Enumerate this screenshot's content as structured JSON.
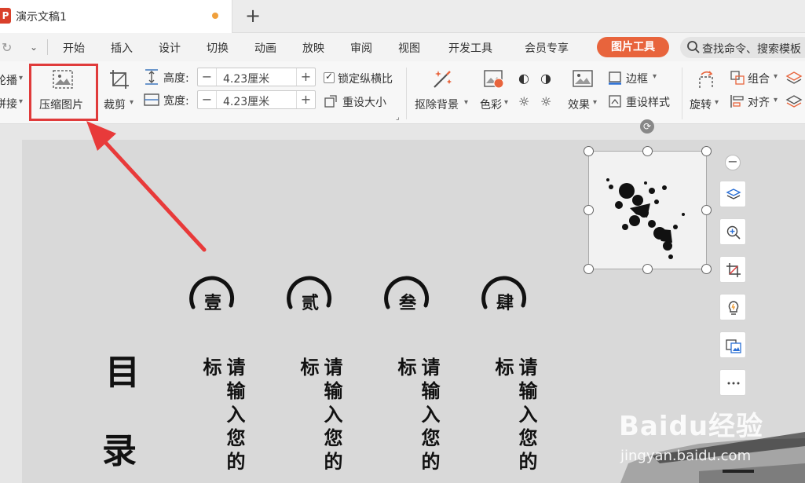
{
  "titlebar": {
    "logo": "P",
    "doc_title": "演示文稿1",
    "new_tab": "+"
  },
  "menu": {
    "items": [
      "开始",
      "插入",
      "设计",
      "切换",
      "动画",
      "放映",
      "审阅",
      "视图",
      "开发工具",
      "会员专享"
    ],
    "active": "图片工具",
    "search_placeholder": "查找命令、搜索模板"
  },
  "ribbon": {
    "left_partial_1": "轮播",
    "left_partial_2": "拼接",
    "compress": "压缩图片",
    "crop": "裁剪",
    "height_label": "高度:",
    "height_value": "4.23厘米",
    "width_label": "宽度:",
    "width_value": "4.23厘米",
    "lock_ratio": "锁定纵横比",
    "reset_size": "重设大小",
    "remove_bg": "抠除背景",
    "color": "色彩",
    "effects": "效果",
    "border": "边框",
    "reset_style": "重设样式",
    "rotate": "旋转",
    "group": "组合",
    "align": "对齐"
  },
  "slide": {
    "title_chars": [
      "目",
      "录"
    ],
    "numbers": [
      "壹",
      "贰",
      "叁",
      "肆"
    ],
    "placeholder": "请输入您的标"
  },
  "watermark": {
    "main": "Baidu经验",
    "sub": "jingyan.baidu.com"
  },
  "colors": {
    "accent": "#e8643c",
    "highlight": "#e03b3b"
  }
}
